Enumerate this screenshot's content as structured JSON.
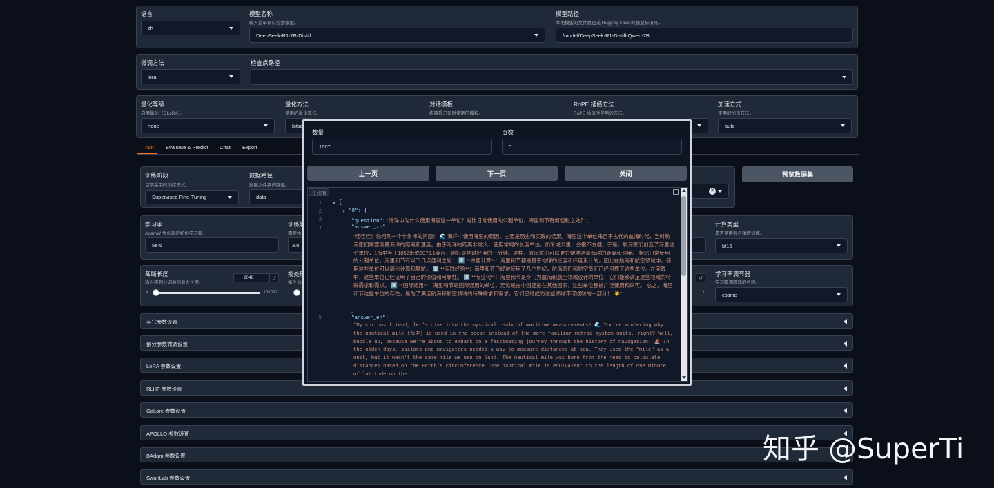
{
  "row1": {
    "lang_label": "语言",
    "lang_value": "zh",
    "model_name_label": "模型名称",
    "model_name_sub": "输入首单词以检索模型。",
    "model_name_value": "DeepSeek-R1-7B-Distill",
    "model_path_label": "模型路径",
    "model_path_sub": "本地模型的文件路径或 Hugging Face 的模型标识符。",
    "model_path_value": "/model/DeepSeek-R1-Distill-Qwen-7B"
  },
  "row2": {
    "finetune_label": "微调方法",
    "finetune_value": "lora",
    "ckpt_label": "检查点路径"
  },
  "row3": {
    "quant_label": "量化等级",
    "quant_sub": "启用量化（QLoRA）。",
    "quant_value": "none",
    "qmethod_label": "量化方法",
    "qmethod_sub": "使用的量化算法。",
    "qmethod_value": "bitsa",
    "template_label": "对话模板",
    "template_sub": "构建提示词时使用的模板。",
    "rope_label": "RoPE 插值方法",
    "rope_sub": "RoPE 插值时使用的方法。",
    "accel_label": "加速方式",
    "accel_sub": "使用的加速方法。",
    "accel_value": "auto"
  },
  "tabs": [
    "Train",
    "Evaluate & Predict",
    "Chat",
    "Export"
  ],
  "train": {
    "stage_label": "训练阶段",
    "stage_sub": "目前采用的训练方式。",
    "stage_value": "Supervised Fine-Tuning",
    "datadir_label": "数据路径",
    "datadir_sub": "数据文件夹的路径。",
    "datadir_value": "data",
    "preview_button": "预览数据集",
    "lr_label": "学习率",
    "lr_sub": "AdamW 优化器的初始学习率。",
    "lr_value": "5e-5",
    "epochs_label": "训练轮数",
    "epochs_sub": "需要执",
    "epochs_value": "3.0",
    "compute_label": "计算类型",
    "compute_sub": "是否使用混合精度训练。",
    "compute_value": "bf16",
    "cutoff_label": "截断长度",
    "cutoff_sub": "输入序列分词后的最大长度。",
    "cutoff_value": "2048",
    "cutoff_min": "4",
    "cutoff_max": "131072",
    "batch_label": "批处理",
    "batch_sub": "每个 GPU",
    "right_slider_max": "1",
    "sched_label": "学习率调节器",
    "sched_sub": "学习率调度器的名称。",
    "sched_value": "cosine"
  },
  "accordions": [
    "其它参数设置",
    "部分参数微调设置",
    "LoRA 参数设置",
    "RLHF 参数设置",
    "GaLore 参数设置",
    "APOLLO 参数设置",
    "BAdam 参数设置",
    "SwanLab 参数设置"
  ],
  "modal": {
    "count_label": "数量",
    "count_value": "1607",
    "page_label": "页数",
    "page_value": "0",
    "prev_button": "上一页",
    "next_button": "下一页",
    "close_button": "关闭",
    "sample_label": "样例",
    "line_numbers": [
      "1",
      "2",
      "3",
      "4",
      "5"
    ],
    "json_open": "[",
    "key0": "\"0\": {",
    "question_key": "\"question\":",
    "question_value": "\"海洋中为什么使用海里这一单位？对比日常使用的公制单位，海里和节有何便利之处？\",",
    "answer_zh_key": "\"answer_zh\":",
    "answer_zh_value": "\"哇哇哇！你问到一个非常棒的问题！ 🌊 海洋中使用海里的原因，主要是历史和实践的结果。海里这个单位来自于古代的航海时代，当时航海家们需要测量海洋的距离和速度。由于海洋的距离非常大，使用常规的长度单位，如米或公里，会很不方便。于是，航海家们创造了海里这个单位，1海里等于1852米或6076.1英尺，刚好是地球经度的一分钟。这样，航海家们可以更方便地测量海洋的距离和速度。 相比日常使用的公制单位，海里和节有以下几点便利之处： 1️⃣ **方便计算**：海里和节都是基于地球的经度和纬度设计的，因此在航海和航空领域中，使用这些单位可以简化计算和导航。 2️⃣ **实践经验**：海里和节已经被使用了几个世纪，航海家们和航空员们已经习惯了这些单位。在实践中，这些单位已经证明了自己的价值和可靠性。 3️⃣ **专业化**：海里和节是专门为航海和航空领域设计的单位，它们能够满足这些领域的特殊需求和需求。 4️⃣ **国际通用**：海里和节是国际通用的单位，无论是在中国还是在其他国家，这些单位都被广泛使用和认可。 总之，海里和节这些单位的存在，是为了满足航海和航空领域的特殊需求和需求，它们已经成为这些领域不可或缺的一部分！ ☀️\"",
    "comma": ",",
    "answer_en_key": "\"answer_en\":",
    "answer_en_value": "\"My curious friend, let's dive into the mystical realm of maritime measurements! 🌊 You're wondering why the nautical mile (海里) is used in the ocean instead of the more familiar metric system units, right? Well, buckle up, because we're about to embark on a fascinating journey through the history of navigation! ⛵ In the olden days, sailors and navigators needed a way to measure distances at sea. They used the \"mile\" as a unit, but it wasn't the same mile we use on land. The nautical mile was born from the need to calculate distances based on the Earth's circumference. One nautical mile is equivalent to the length of one minute of latitude on the"
  },
  "watermark": "知乎 @SuperTi"
}
